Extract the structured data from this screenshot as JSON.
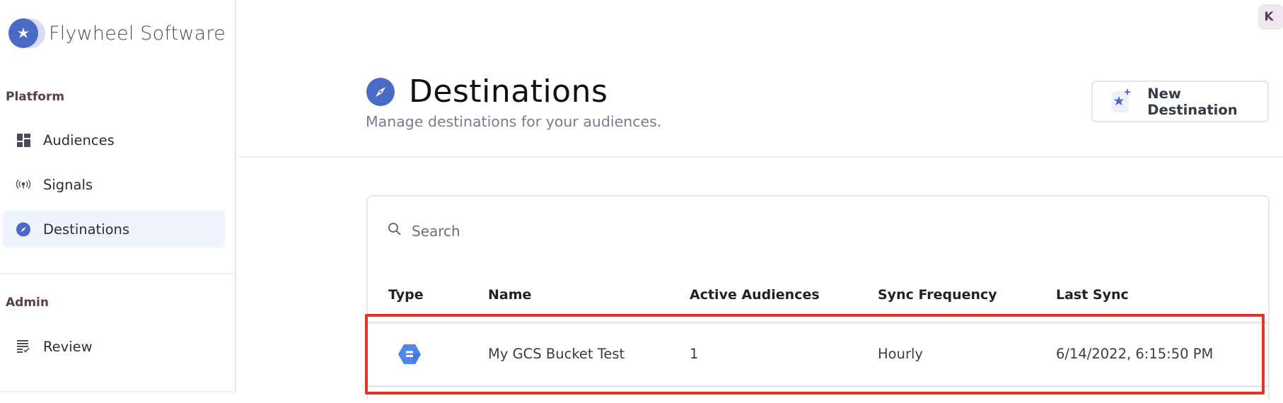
{
  "brand": {
    "name": "Flywheel Software",
    "icon": "flywheel-logo-icon",
    "accent": "#4a6ac8"
  },
  "user": {
    "avatar_initial": "K"
  },
  "sidebar": {
    "sections": [
      {
        "label": "Platform",
        "items": [
          {
            "label": "Audiences",
            "icon": "dashboard-icon",
            "active": false
          },
          {
            "label": "Signals",
            "icon": "broadcast-icon",
            "active": false
          },
          {
            "label": "Destinations",
            "icon": "compass-icon",
            "active": true
          }
        ]
      },
      {
        "label": "Admin",
        "items": [
          {
            "label": "Review",
            "icon": "checklist-icon",
            "active": false
          }
        ]
      }
    ]
  },
  "header": {
    "title": "Destinations",
    "title_icon": "compass-icon",
    "subtitle": "Manage destinations for your audiences.",
    "new_button_label": "New Destination"
  },
  "table": {
    "search": {
      "placeholder": "Search",
      "value": ""
    },
    "columns": [
      "Type",
      "Name",
      "Active Audiences",
      "Sync Frequency",
      "Last Sync"
    ],
    "rows": [
      {
        "type_icon": "google-cloud-storage-icon",
        "name": "My GCS Bucket Test",
        "active_audiences": "1",
        "sync_frequency": "Hourly",
        "last_sync": "6/14/2022, 6:15:50 PM",
        "highlighted": true
      }
    ]
  },
  "colors": {
    "highlight_border": "#e3342a",
    "active_nav_bg": "#eef3fd",
    "section_label": "#5a3d52",
    "gcs_blue": "#4f86ec"
  }
}
